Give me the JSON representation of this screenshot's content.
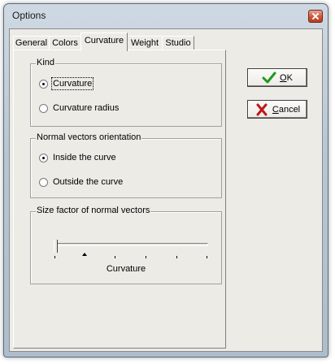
{
  "window": {
    "title": "Options"
  },
  "tabs": [
    {
      "label": "General"
    },
    {
      "label": "Colors"
    },
    {
      "label": "Curvature",
      "active": true
    },
    {
      "label": "Weight"
    },
    {
      "label": "Studio"
    }
  ],
  "kind": {
    "label": "Kind",
    "options": [
      {
        "label": "Curvature",
        "checked": true
      },
      {
        "label": "Curvature radius",
        "checked": false
      }
    ]
  },
  "orientation": {
    "label": "Normal vectors orientation",
    "options": [
      {
        "label": "Inside the curve",
        "checked": true
      },
      {
        "label": "Outside the curve",
        "checked": false
      }
    ]
  },
  "size_factor": {
    "label": "Size factor of normal vectors",
    "value_label": "Curvature",
    "level": 0
  },
  "buttons": {
    "ok": {
      "label_prefix": "",
      "mnemonic": "O",
      "label_rest": "K",
      "icon": "check-icon",
      "color": "#1f9a1f"
    },
    "cancel": {
      "label_prefix": "",
      "mnemonic": "C",
      "label_rest": "ancel",
      "icon": "x-icon",
      "color": "#c0181c"
    }
  }
}
